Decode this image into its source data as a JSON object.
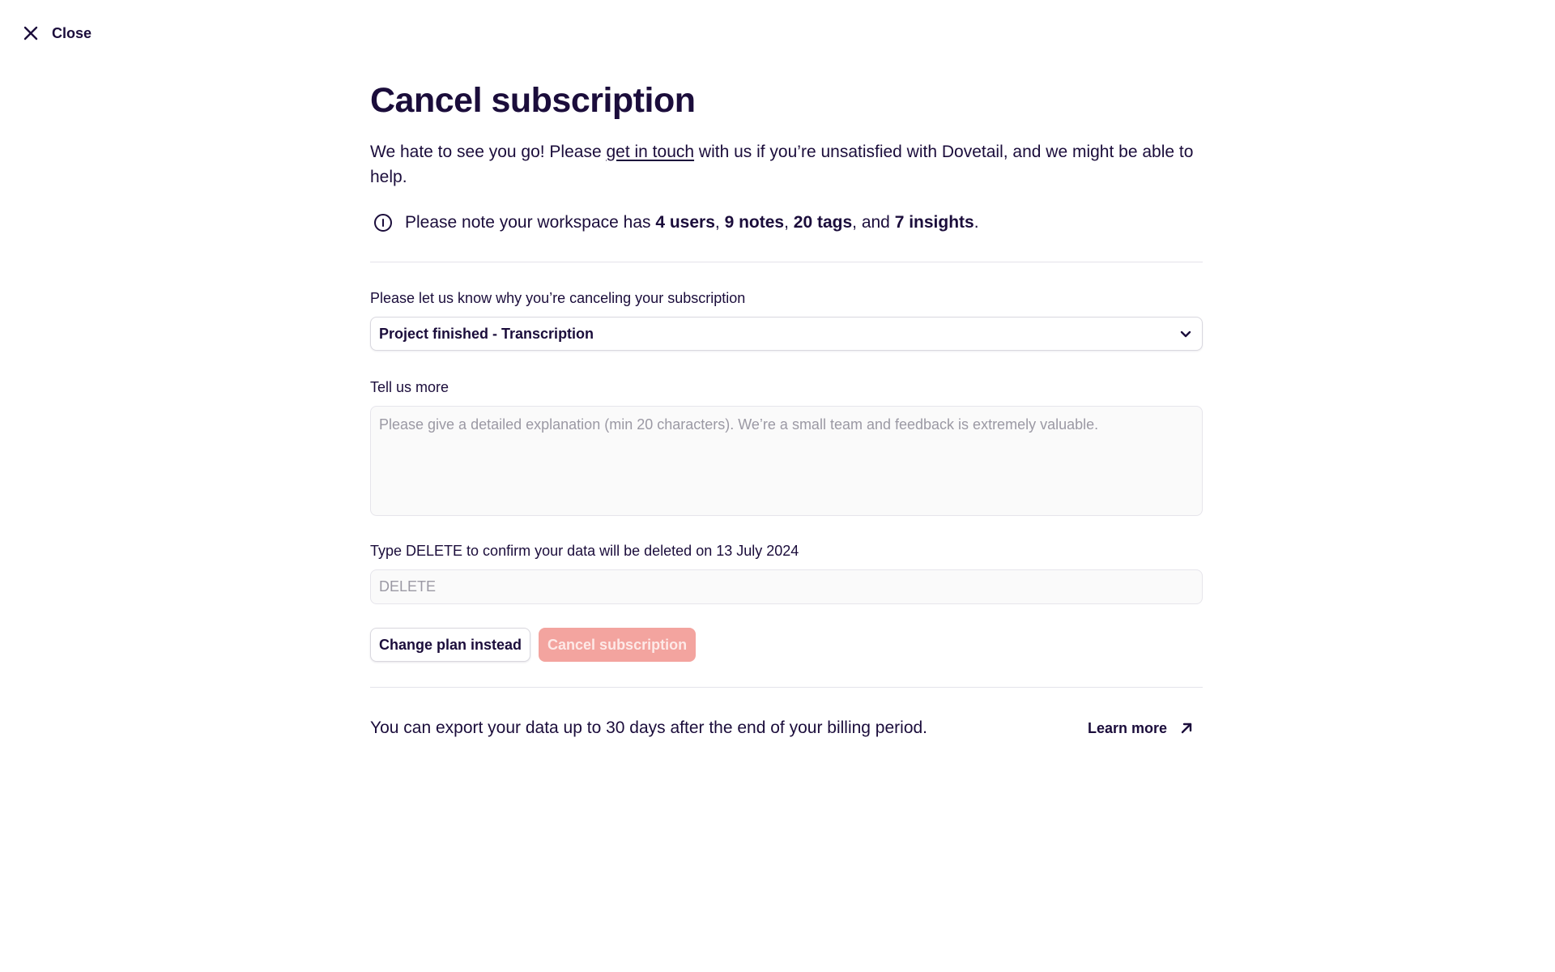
{
  "close": {
    "label": "Close",
    "icon": "close-icon"
  },
  "page": {
    "title": "Cancel subscription",
    "intro_before_link": "We hate to see you go! Please ",
    "intro_link": "get in touch",
    "intro_after_link": " with us if you’re unsatisfied with Dovetail, and we might be able to help."
  },
  "note": {
    "icon": "info-icon",
    "prefix": "Please note your workspace has ",
    "users": "4 users",
    "sep1": ", ",
    "notes": "9 notes",
    "sep2": ", ",
    "tags": "20 tags",
    "sep3": ", and ",
    "insights": "7 insights",
    "suffix": "."
  },
  "reason": {
    "label": "Please let us know why you’re canceling your subscription",
    "selected": "Project finished - Transcription",
    "icon": "chevron-down-icon"
  },
  "details": {
    "label": "Tell us more",
    "placeholder": "Please give a detailed explanation (min 20 characters). We’re a small team and feedback is extremely valuable.",
    "value": ""
  },
  "confirm": {
    "label": "Type DELETE to confirm your data will be deleted on 13 July 2024",
    "placeholder": "DELETE",
    "value": ""
  },
  "actions": {
    "change_plan": "Change plan instead",
    "cancel_subscription": "Cancel subscription"
  },
  "footer": {
    "text": "You can export your data up to 30 days after the end of your billing period.",
    "learn_more": "Learn more",
    "learn_more_icon": "arrow-up-right-icon"
  },
  "colors": {
    "text": "#1b0d3b",
    "danger_disabled": "#f3a49f",
    "divider": "#e4e3ea"
  }
}
